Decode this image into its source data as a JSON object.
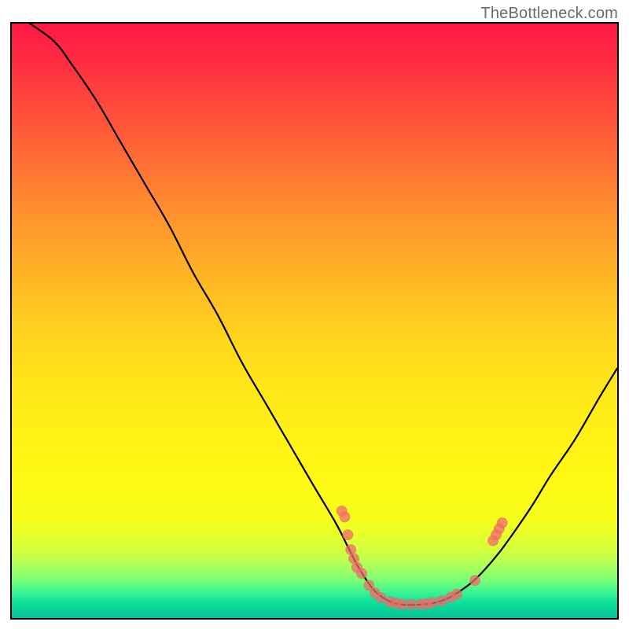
{
  "watermark": "TheBottleneck.com",
  "chart_data": {
    "type": "line",
    "title": "",
    "xlabel": "",
    "ylabel": "",
    "xlim": [
      0,
      100
    ],
    "ylim": [
      0,
      100
    ],
    "curve": [
      {
        "x": 3,
        "y": 100
      },
      {
        "x": 7,
        "y": 97
      },
      {
        "x": 10,
        "y": 93
      },
      {
        "x": 14,
        "y": 87
      },
      {
        "x": 18,
        "y": 80
      },
      {
        "x": 22,
        "y": 73
      },
      {
        "x": 26,
        "y": 66
      },
      {
        "x": 30,
        "y": 58
      },
      {
        "x": 34,
        "y": 51
      },
      {
        "x": 38,
        "y": 43
      },
      {
        "x": 42,
        "y": 36
      },
      {
        "x": 46,
        "y": 29
      },
      {
        "x": 50,
        "y": 22
      },
      {
        "x": 53.5,
        "y": 16
      },
      {
        "x": 55.5,
        "y": 12
      },
      {
        "x": 57,
        "y": 9
      },
      {
        "x": 58.5,
        "y": 6.5
      },
      {
        "x": 60,
        "y": 4.5
      },
      {
        "x": 62,
        "y": 3
      },
      {
        "x": 64,
        "y": 2.3
      },
      {
        "x": 66,
        "y": 2.2
      },
      {
        "x": 68,
        "y": 2.3
      },
      {
        "x": 70,
        "y": 2.6
      },
      {
        "x": 72,
        "y": 3.3
      },
      {
        "x": 74,
        "y": 4.5
      },
      {
        "x": 76,
        "y": 6
      },
      {
        "x": 78,
        "y": 8
      },
      {
        "x": 80.5,
        "y": 11
      },
      {
        "x": 83,
        "y": 14.5
      },
      {
        "x": 86,
        "y": 19
      },
      {
        "x": 89,
        "y": 24
      },
      {
        "x": 93,
        "y": 30
      },
      {
        "x": 97,
        "y": 37
      },
      {
        "x": 100,
        "y": 42
      }
    ],
    "markers": [
      {
        "x": 54.5,
        "y": 18
      },
      {
        "x": 55,
        "y": 17
      },
      {
        "x": 55.5,
        "y": 14
      },
      {
        "x": 56,
        "y": 11.5
      },
      {
        "x": 56.5,
        "y": 10
      },
      {
        "x": 57,
        "y": 8.5
      },
      {
        "x": 59,
        "y": 5.5
      },
      {
        "x": 57.8,
        "y": 7.5
      },
      {
        "x": 60,
        "y": 4.2
      },
      {
        "x": 61,
        "y": 3.4
      },
      {
        "x": 62.5,
        "y": 2.7
      },
      {
        "x": 63.5,
        "y": 2.5
      },
      {
        "x": 64.5,
        "y": 2.3
      },
      {
        "x": 66,
        "y": 2.3
      },
      {
        "x": 67.5,
        "y": 2.3
      },
      {
        "x": 68.5,
        "y": 2.4
      },
      {
        "x": 69.5,
        "y": 2.6
      },
      {
        "x": 71,
        "y": 2.9
      },
      {
        "x": 72.5,
        "y": 3.5
      },
      {
        "x": 73.5,
        "y": 4
      },
      {
        "x": 76.5,
        "y": 6.3
      },
      {
        "x": 79.5,
        "y": 13
      },
      {
        "x": 80,
        "y": 14
      },
      {
        "x": 80.5,
        "y": 15
      },
      {
        "x": 81,
        "y": 16
      }
    ]
  }
}
